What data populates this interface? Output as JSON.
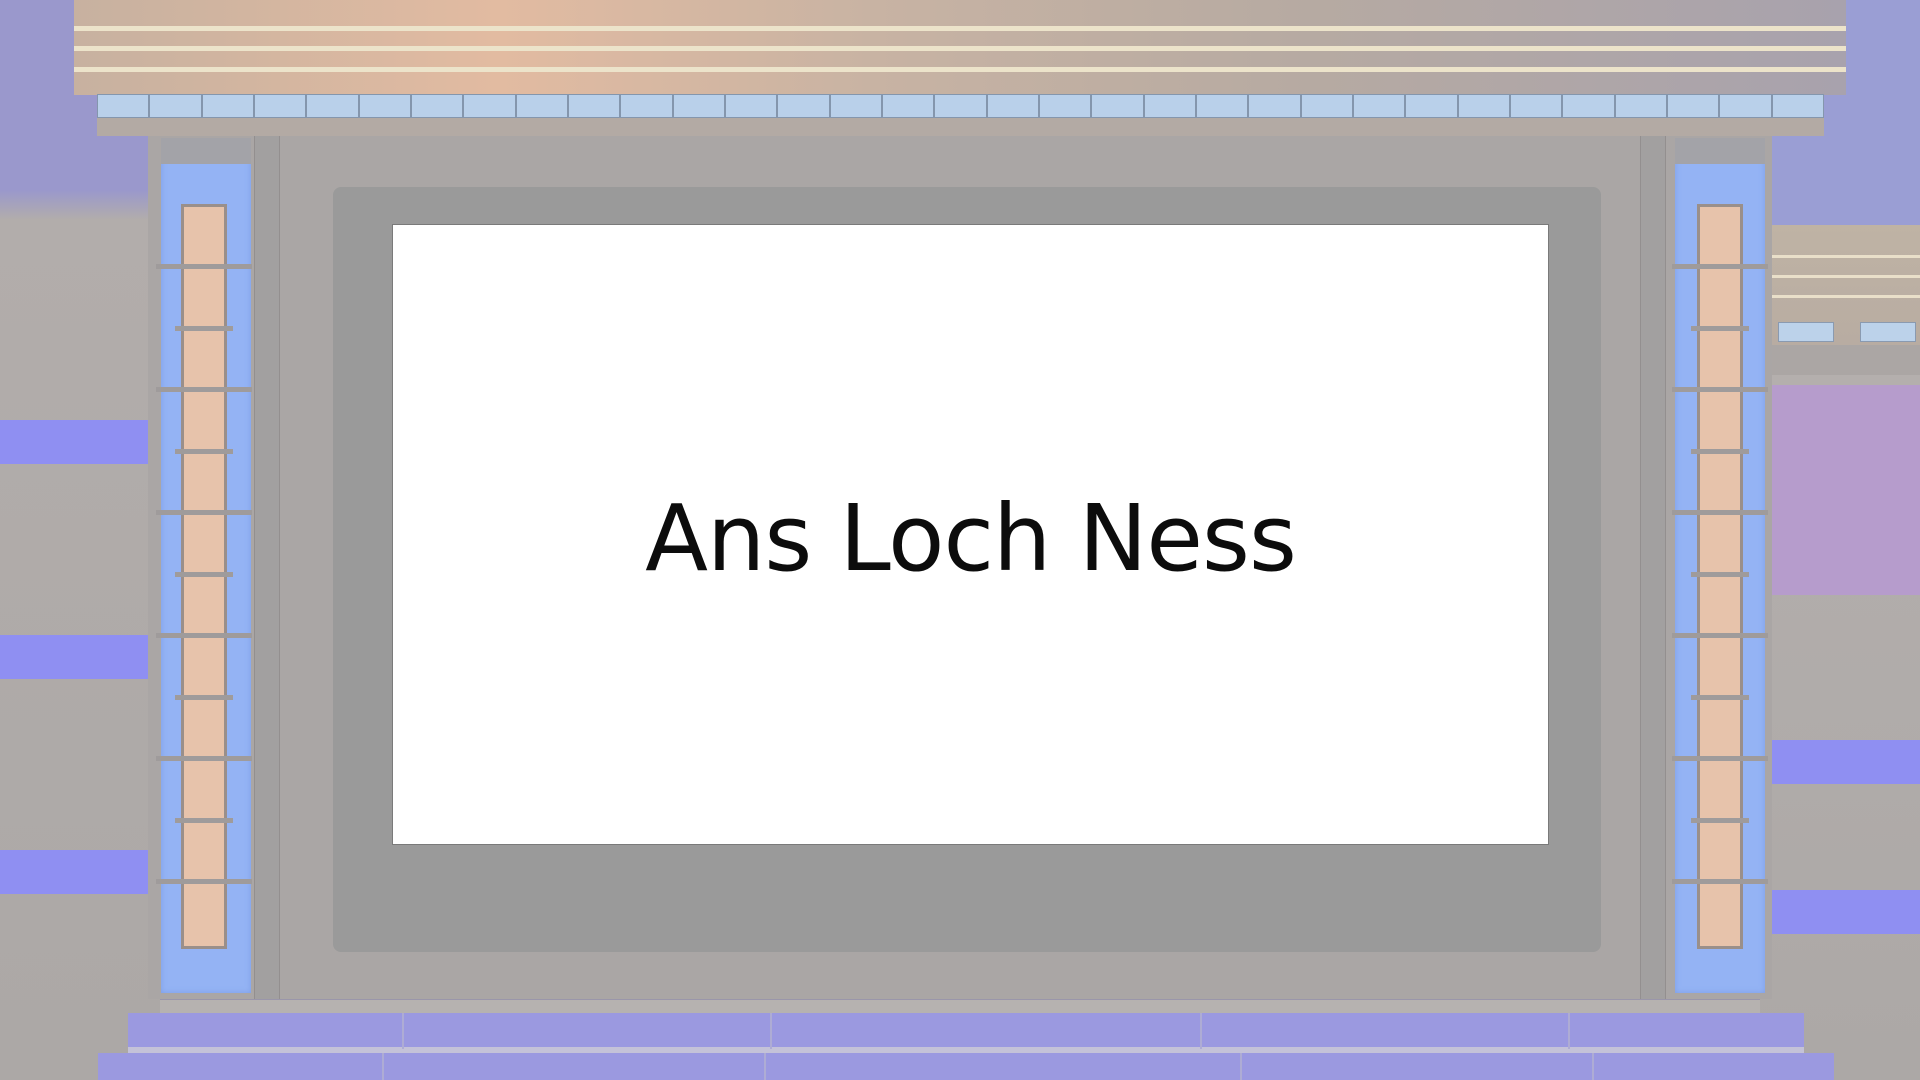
{
  "screen": {
    "text": "Ans Loch Ness"
  },
  "colors": {
    "screen_background": "#ffffff",
    "bezel": "#9a9a9a",
    "pillar_glow": "#94b3f4",
    "pillar_panel": "#e7c3ab",
    "stage": "#9b99e0",
    "accent_stripe": "#8f8ff2"
  },
  "icons": {
    "decor": [
      "header-light-tile",
      "pillar-light-panel",
      "stage-step"
    ]
  }
}
